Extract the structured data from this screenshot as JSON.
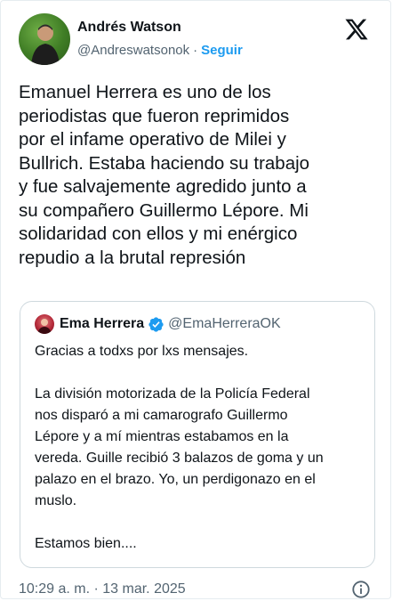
{
  "author": {
    "name": "Andrés Watson",
    "handle": "@Andreswatsonok",
    "separator": "·",
    "follow_label": "Seguir"
  },
  "icons": {
    "platform": "x-logo-icon",
    "verified": "verified-badge-icon",
    "info": "info-icon"
  },
  "colors": {
    "accent": "#1d9bf0",
    "muted": "#536471",
    "text": "#0f1419",
    "border": "#cfd9de"
  },
  "tweet": {
    "text": "Emanuel Herrera es uno de los\nperiodistas que fueron reprimidos\npor el infame operativo de Milei y\nBullrich. Estaba haciendo su trabajo\ny fue salvajemente agredido junto a\nsu compañero Guillermo Lépore. Mi\nsolidaridad con ellos y mi enérgico\nrepudio a la brutal represión"
  },
  "quote": {
    "name": "Ema Herrera",
    "handle": "@EmaHerreraOK",
    "text": "Gracias a todxs por lxs mensajes.\n\nLa división motorizada de la Policía Federal\nnos disparó a mi camarografo  Guillermo\nLépore y a mí mientras estabamos en la\nvereda. Guille recibió 3 balazos de goma y un\npalazo en el brazo. Yo, un perdigonazo en el\nmuslo.\n\nEstamos bien...."
  },
  "footer": {
    "timestamp": "10:29 a. m. · 13 mar. 2025"
  }
}
